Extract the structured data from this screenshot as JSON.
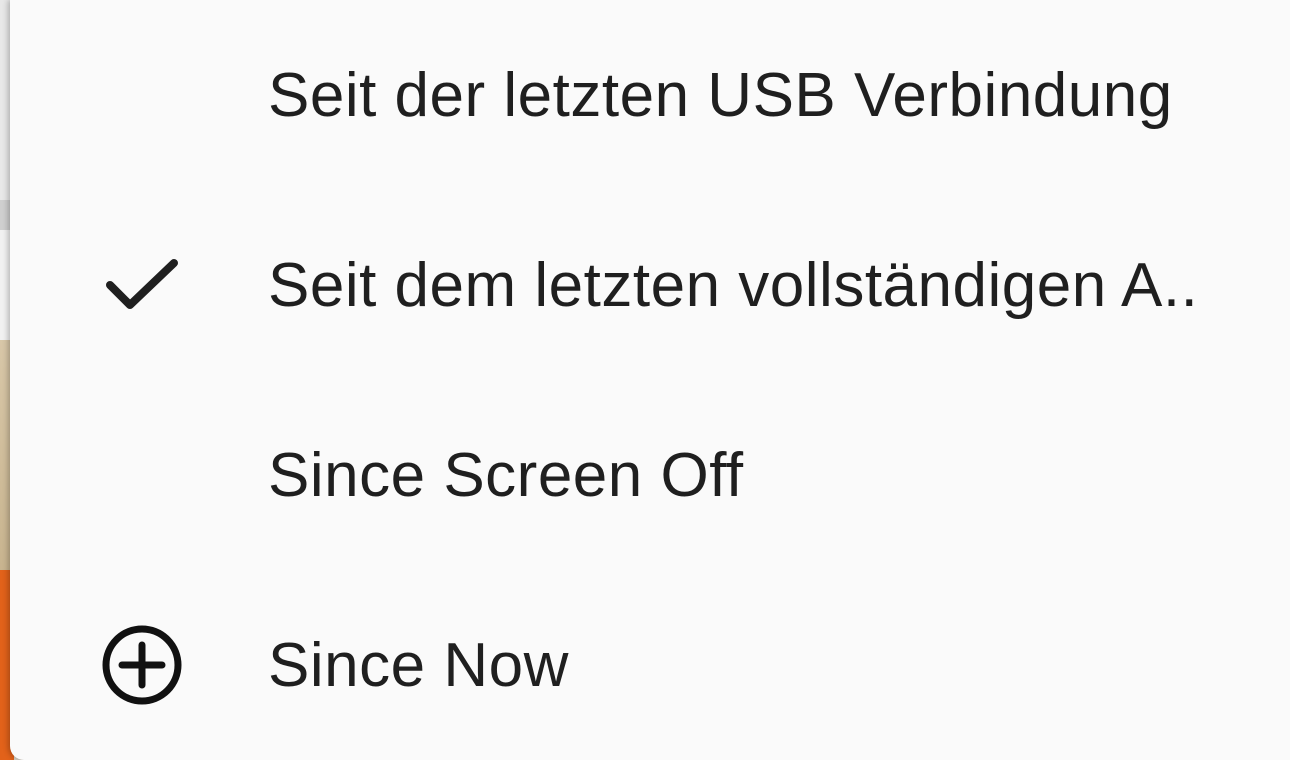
{
  "menu": {
    "items": [
      {
        "label": "Seit der letzten USB Verbindung",
        "icon": null,
        "selected": false
      },
      {
        "label": "Seit dem letzten vollständigen A..",
        "icon": "check-icon",
        "selected": true
      },
      {
        "label": "Since Screen Off",
        "icon": null,
        "selected": false
      },
      {
        "label": "Since Now",
        "icon": "add-circle-icon",
        "selected": false
      }
    ]
  },
  "colors": {
    "menu_background": "#fafafa",
    "text": "#1f1f1f",
    "background_accent": "#e2621a"
  }
}
